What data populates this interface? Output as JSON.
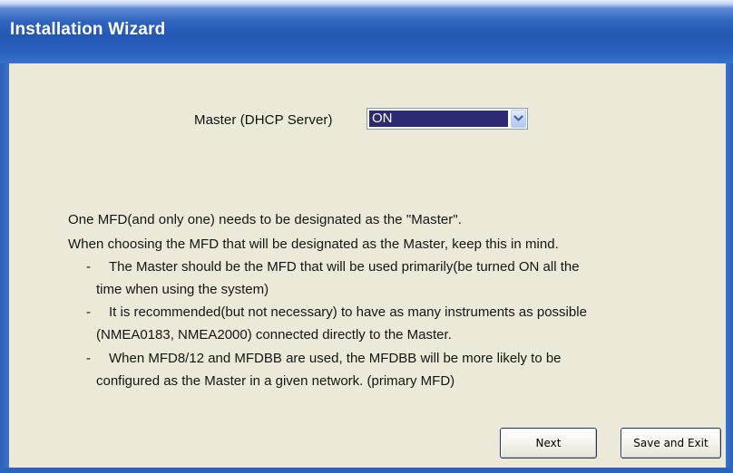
{
  "window": {
    "title": "Installation Wizard"
  },
  "master": {
    "label": "Master (DHCP Server)",
    "selected_value": "ON",
    "arrow_icon": "chevron-down-icon"
  },
  "description": {
    "line1": "One MFD(and only one) needs to be designated as the \"Master\".",
    "line2": "When choosing the MFD that will be designated as the Master, keep this in mind.",
    "bullets": [
      {
        "marker": "-",
        "lines": [
          "The Master should be the MFD that will be used primarily(be turned ON all the",
          "time when using the system)"
        ]
      },
      {
        "marker": "-",
        "lines": [
          "It is recommended(but not necessary) to have as many instruments as possible",
          "(NMEA0183, NMEA2000) connected directly to the Master."
        ]
      },
      {
        "marker": "-",
        "lines": [
          "When MFD8/12 and MFDBB are used, the MFDBB will be more likely to be",
          "configured as the Master in a given network. (primary MFD)"
        ]
      }
    ]
  },
  "buttons": {
    "next": "Next",
    "save_exit": "Save and Exit"
  },
  "colors": {
    "titlebar": "#2458b3",
    "content_bg": "#ece9d8",
    "selection_bg": "#2b2a72"
  }
}
